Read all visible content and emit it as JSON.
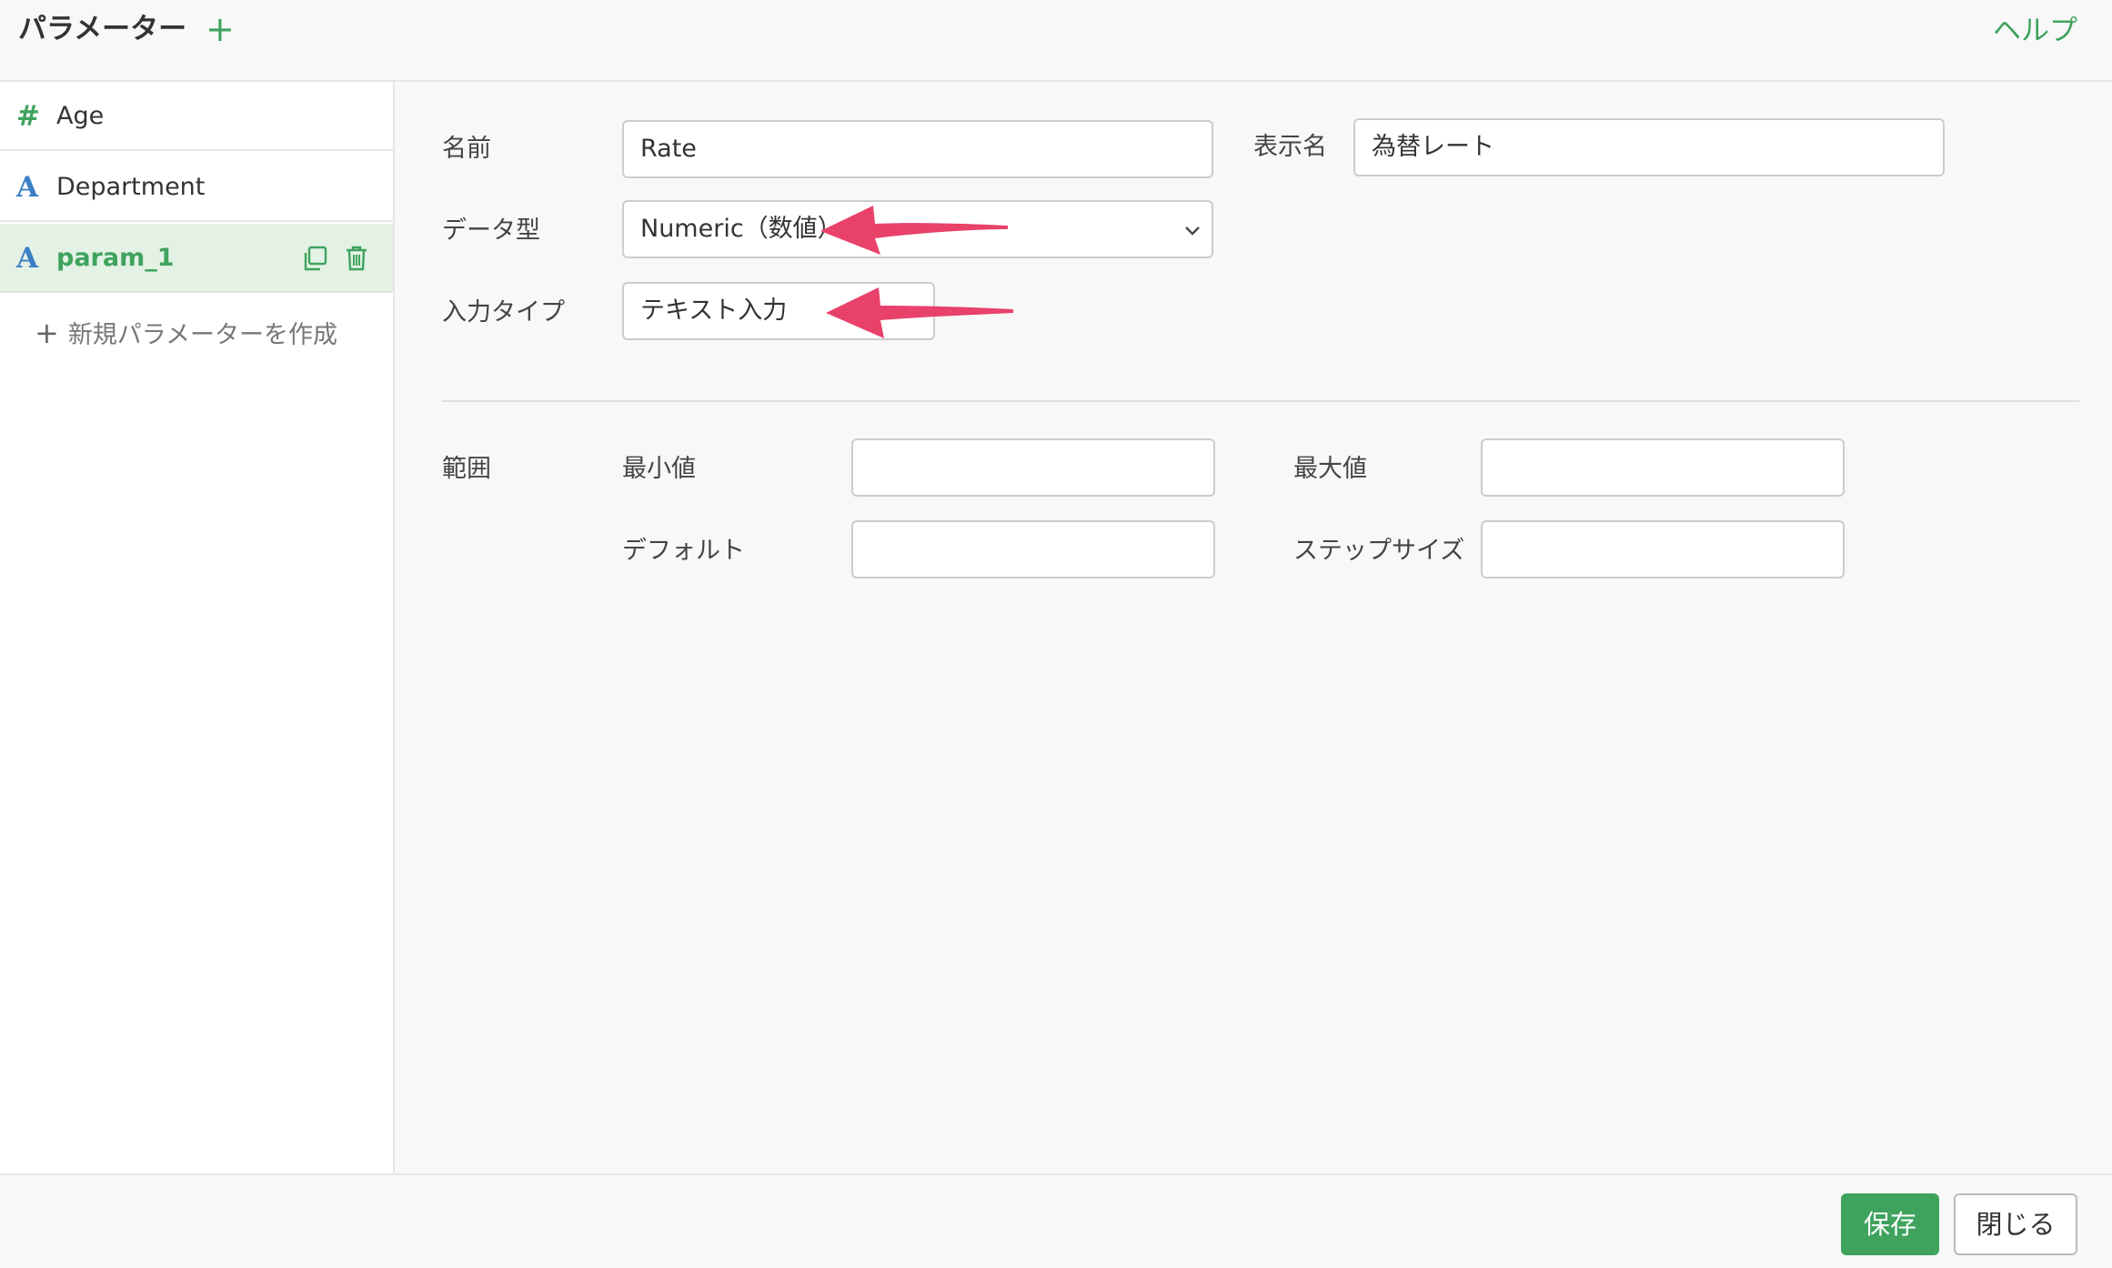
{
  "header": {
    "title": "パラメーター",
    "add_symbol": "+",
    "help_label": "ヘルプ"
  },
  "sidebar": {
    "items": [
      {
        "type_symbol": "#",
        "label": "Age"
      },
      {
        "type_symbol": "A",
        "label": "Department"
      },
      {
        "type_symbol": "A",
        "label": "param_1"
      }
    ],
    "new_param_plus": "+",
    "new_param_label": "新規パラメーターを作成"
  },
  "form": {
    "name_label": "名前",
    "name_value": "Rate",
    "display_name_label": "表示名",
    "display_name_value": "為替レート",
    "data_type_label": "データ型",
    "data_type_value": "Numeric（数値）",
    "input_type_label": "入力タイプ",
    "input_type_value": "テキスト入力",
    "range_label": "範囲",
    "min_label": "最小値",
    "min_value": "",
    "max_label": "最大値",
    "max_value": "",
    "default_label": "デフォルト",
    "default_value": "",
    "step_label": "ステップサイズ",
    "step_value": ""
  },
  "footer": {
    "save_label": "保存",
    "close_label": "閉じる"
  },
  "colors": {
    "accent_green": "#3fa35d",
    "text_type_blue": "#3c7fc6",
    "annotation_arrow": "#e8426a",
    "active_item_bg": "#e3f2e5"
  }
}
